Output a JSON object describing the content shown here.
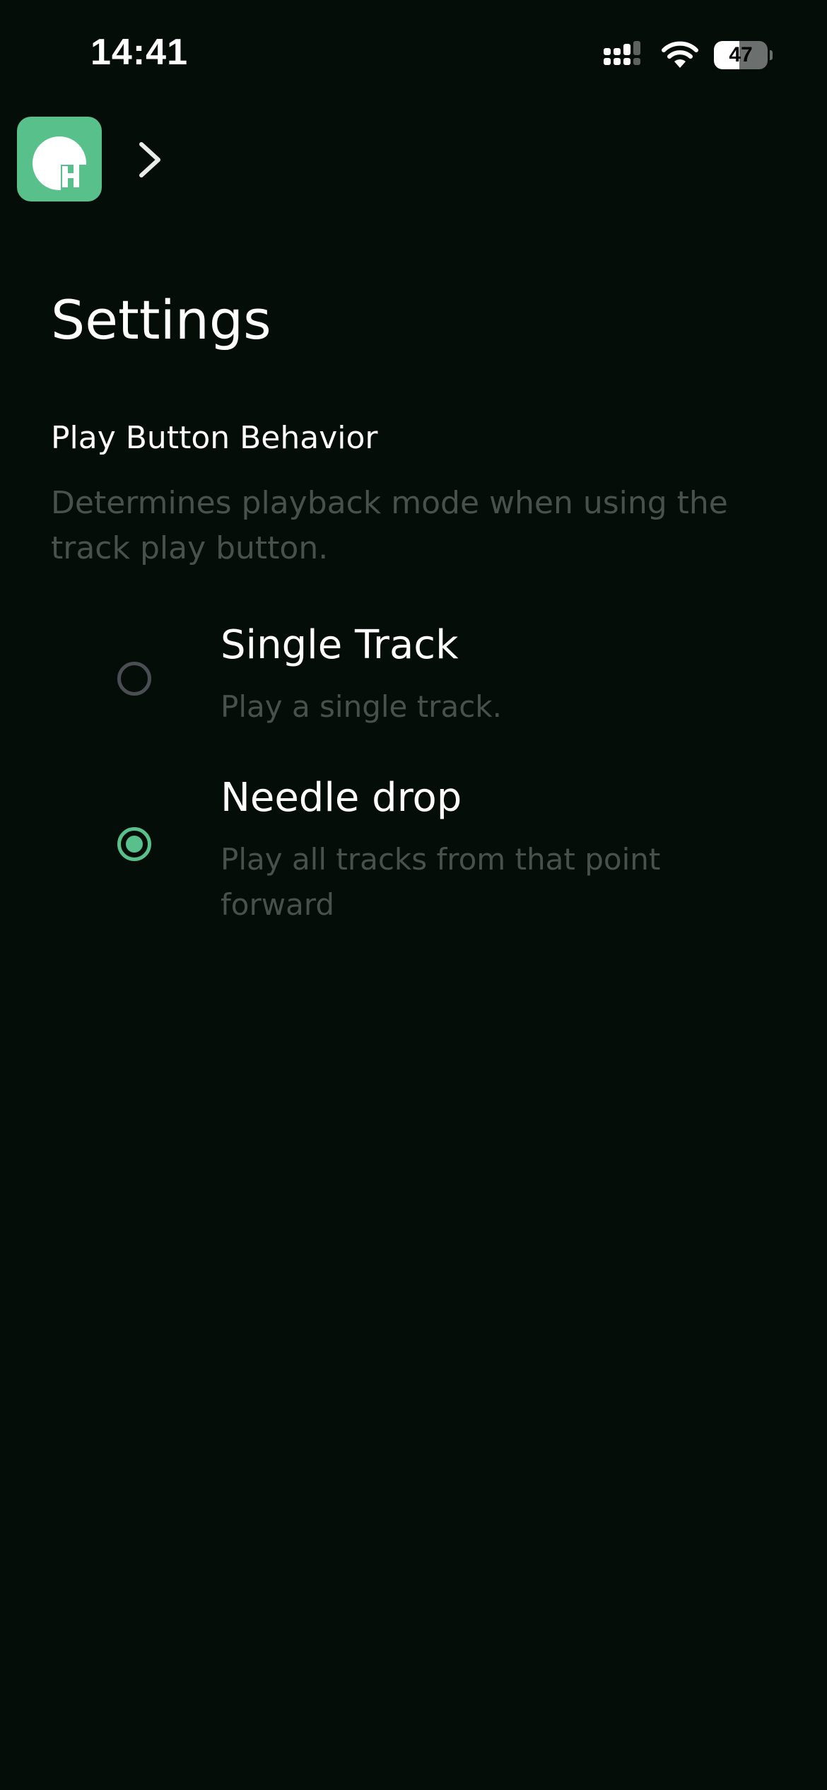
{
  "status_bar": {
    "time": "14:41",
    "battery_level": 47,
    "battery_text": "47"
  },
  "nav": {
    "logo_icon": "app-logo-icon",
    "chevron_icon": "chevron-right-icon"
  },
  "page": {
    "title": "Settings"
  },
  "section": {
    "heading": "Play Button Behavior",
    "description": "Determines playback mode when using the track play button."
  },
  "options": [
    {
      "label": "Single Track",
      "description": "Play a single track.",
      "selected": false
    },
    {
      "label": "Needle drop",
      "description": "Play all tracks from that point forward",
      "selected": true
    }
  ],
  "colors": {
    "background": "#050d09",
    "accent": "#57c08b",
    "muted_text": "#4a514d",
    "radio_unselected": "#4a4d52"
  }
}
